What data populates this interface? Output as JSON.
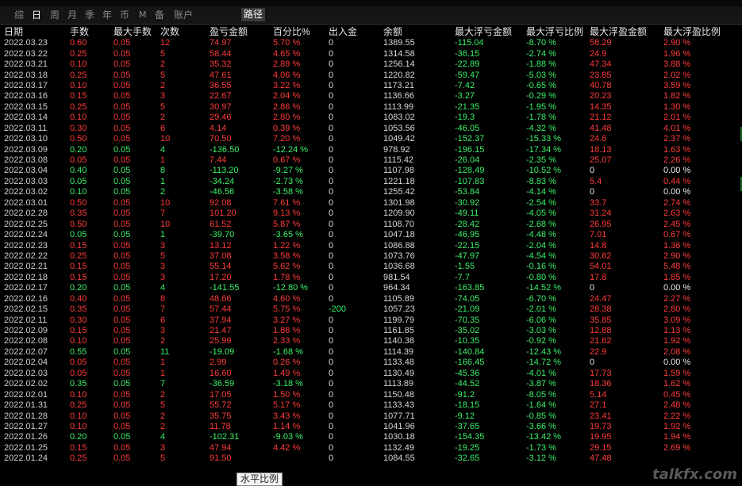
{
  "toolbar": {
    "periods": [
      "综",
      "日",
      "周",
      "月",
      "季",
      "年",
      "币",
      "M",
      "备",
      "账户"
    ],
    "active_period": "日",
    "path_button": "路径"
  },
  "columns": [
    "日期",
    "手数",
    "最大手数",
    "次数",
    "盈亏金额",
    "百分比%",
    "出入金",
    "余额",
    "最大浮亏金额",
    "最大浮亏比例",
    "最大浮盈金额",
    "最大浮盈比例"
  ],
  "rows": [
    [
      "2022.03.23",
      "0.60",
      "0.05",
      "12",
      "74.97",
      "5.70 %",
      "0",
      "1389.55",
      "-115.04",
      "-8.70 %",
      "58.29",
      "2.90 %"
    ],
    [
      "2022.03.22",
      "0.25",
      "0.05",
      "5",
      "58.44",
      "4.65 %",
      "0",
      "1314.58",
      "-36.15",
      "-2.74 %",
      "24.9",
      "1.96 %"
    ],
    [
      "2022.03.21",
      "0.10",
      "0.05",
      "2",
      "35.32",
      "2.89 %",
      "0",
      "1256.14",
      "-22.89",
      "-1.88 %",
      "47.34",
      "3.88 %"
    ],
    [
      "2022.03.18",
      "0.25",
      "0.05",
      "5",
      "47.61",
      "4.06 %",
      "0",
      "1220.82",
      "-59.47",
      "-5.03 %",
      "23.85",
      "2.02 %"
    ],
    [
      "2022.03.17",
      "0.10",
      "0.05",
      "2",
      "36.55",
      "3.22 %",
      "0",
      "1173.21",
      "-7.42",
      "-0.65 %",
      "40.78",
      "3.59 %"
    ],
    [
      "2022.03.16",
      "0.15",
      "0.05",
      "3",
      "22.67",
      "2.04 %",
      "0",
      "1136.66",
      "-3.27",
      "-0.29 %",
      "20.23",
      "1.82 %"
    ],
    [
      "2022.03.15",
      "0.25",
      "0.05",
      "5",
      "30.97",
      "2.86 %",
      "0",
      "1113.99",
      "-21.35",
      "-1.95 %",
      "14.35",
      "1.30 %"
    ],
    [
      "2022.03.14",
      "0.10",
      "0.05",
      "2",
      "29.46",
      "2.80 %",
      "0",
      "1083.02",
      "-19.3",
      "-1.78 %",
      "21.12",
      "2.01 %"
    ],
    [
      "2022.03.11",
      "0.30",
      "0.05",
      "6",
      "4.14",
      "0.39 %",
      "0",
      "1053.56",
      "-46.05",
      "-4.32 %",
      "41.48",
      "4.01 %"
    ],
    [
      "2022.03.10",
      "0.50",
      "0.05",
      "10",
      "70.50",
      "7.20 %",
      "0",
      "1049.42",
      "-152.37",
      "-15.33 %",
      "24.6",
      "2.37 %"
    ],
    [
      "2022.03.09",
      "0.20",
      "0.05",
      "4",
      "-136.50",
      "-12.24 %",
      "0",
      "978.92",
      "-196.15",
      "-17.34 %",
      "18.13",
      "1.63 %"
    ],
    [
      "2022.03.08",
      "0.05",
      "0.05",
      "1",
      "7.44",
      "0.67 %",
      "0",
      "1115.42",
      "-26.04",
      "-2.35 %",
      "25.07",
      "2.26 %"
    ],
    [
      "2022.03.04",
      "0.40",
      "0.05",
      "8",
      "-113.20",
      "-9.27 %",
      "0",
      "1107.98",
      "-128.49",
      "-10.52 %",
      "0",
      "0.00 %"
    ],
    [
      "2022.03.03",
      "0.05",
      "0.05",
      "1",
      "-34.24",
      "-2.73 %",
      "0",
      "1221.18",
      "-107.83",
      "-8.83 %",
      "5.4",
      "0.44 %"
    ],
    [
      "2022.03.02",
      "0.10",
      "0.05",
      "2",
      "-46.56",
      "-3.58 %",
      "0",
      "1255.42",
      "-53.84",
      "-4.14 %",
      "0",
      "0.00 %"
    ],
    [
      "2022.03.01",
      "0.50",
      "0.05",
      "10",
      "92.08",
      "7.61 %",
      "0",
      "1301.98",
      "-30.92",
      "-2.54 %",
      "33.7",
      "2.74 %"
    ],
    [
      "2022.02.28",
      "0.35",
      "0.05",
      "7",
      "101.20",
      "9.13 %",
      "0",
      "1209.90",
      "-49.11",
      "-4.05 %",
      "31.24",
      "2.63 %"
    ],
    [
      "2022.02.25",
      "0.50",
      "0.05",
      "10",
      "61.52",
      "5.87 %",
      "0",
      "1108.70",
      "-28.42",
      "-2.68 %",
      "26.95",
      "2.45 %"
    ],
    [
      "2022.02.24",
      "0.05",
      "0.05",
      "1",
      "-39.70",
      "-3.65 %",
      "0",
      "1047.18",
      "-46.95",
      "-4.48 %",
      "7.01",
      "0.67 %"
    ],
    [
      "2022.02.23",
      "0.15",
      "0.05",
      "3",
      "13.12",
      "1.22 %",
      "0",
      "1086.88",
      "-22.15",
      "-2.04 %",
      "14.8",
      "1.36 %"
    ],
    [
      "2022.02.22",
      "0.25",
      "0.05",
      "5",
      "37.08",
      "3.58 %",
      "0",
      "1073.76",
      "-47.97",
      "-4.54 %",
      "30.62",
      "2.90 %"
    ],
    [
      "2022.02.21",
      "0.15",
      "0.05",
      "3",
      "55.14",
      "5.62 %",
      "0",
      "1036.68",
      "-1.55",
      "-0.16 %",
      "54.01",
      "5.48 %"
    ],
    [
      "2022.02.18",
      "0.15",
      "0.05",
      "3",
      "17.20",
      "1.78 %",
      "0",
      "981.54",
      "-7.7",
      "-0.80 %",
      "17.8",
      "1.85 %"
    ],
    [
      "2022.02.17",
      "0.20",
      "0.05",
      "4",
      "-141.55",
      "-12.80 %",
      "0",
      "964.34",
      "-163.85",
      "-14.52 %",
      "0",
      "0.00 %"
    ],
    [
      "2022.02.16",
      "0.40",
      "0.05",
      "8",
      "48.66",
      "4.60 %",
      "0",
      "1105.89",
      "-74.05",
      "-6.70 %",
      "24.47",
      "2.27 %"
    ],
    [
      "2022.02.15",
      "0.35",
      "0.05",
      "7",
      "57.44",
      "5.75 %",
      "-200",
      "1057.23",
      "-21.09",
      "-2.01 %",
      "28.38",
      "2.80 %"
    ],
    [
      "2022.02.11",
      "0.30",
      "0.05",
      "6",
      "37.94",
      "3.27 %",
      "0",
      "1199.79",
      "-70.35",
      "-6.06 %",
      "35.85",
      "3.09 %"
    ],
    [
      "2022.02.09",
      "0.15",
      "0.05",
      "3",
      "21.47",
      "1.88 %",
      "0",
      "1161.85",
      "-35.02",
      "-3.03 %",
      "12.88",
      "1.13 %"
    ],
    [
      "2022.02.08",
      "0.10",
      "0.05",
      "2",
      "25.99",
      "2.33 %",
      "0",
      "1140.38",
      "-10.35",
      "-0.92 %",
      "21.62",
      "1.92 %"
    ],
    [
      "2022.02.07",
      "0.55",
      "0.05",
      "11",
      "-19.09",
      "-1.68 %",
      "0",
      "1114.39",
      "-140.84",
      "-12.43 %",
      "22.9",
      "2.08 %"
    ],
    [
      "2022.02.04",
      "0.05",
      "0.05",
      "1",
      "2.99",
      "0.26 %",
      "0",
      "1133.48",
      "-166.45",
      "-14.72 %",
      "0",
      "0.00 %"
    ],
    [
      "2022.02.03",
      "0.05",
      "0.05",
      "1",
      "16.60",
      "1.49 %",
      "0",
      "1130.49",
      "-45.36",
      "-4.01 %",
      "17.73",
      "1.59 %"
    ],
    [
      "2022.02.02",
      "0.35",
      "0.05",
      "7",
      "-36.59",
      "-3.18 %",
      "0",
      "1113.89",
      "-44.52",
      "-3.87 %",
      "18.36",
      "1.62 %"
    ],
    [
      "2022.02.01",
      "0.10",
      "0.05",
      "2",
      "17.05",
      "1.50 %",
      "0",
      "1150.48",
      "-91.2",
      "-8.05 %",
      "5.14",
      "0.45 %"
    ],
    [
      "2022.01.31",
      "0.25",
      "0.05",
      "5",
      "55.72",
      "5.17 %",
      "0",
      "1133.43",
      "-18.15",
      "-1.64 %",
      "27.1",
      "2.48 %"
    ],
    [
      "2022.01.28",
      "0.10",
      "0.05",
      "2",
      "35.75",
      "3.43 %",
      "0",
      "1077.71",
      "-9.12",
      "-0.85 %",
      "23.41",
      "2.22 %"
    ],
    [
      "2022.01.27",
      "0.10",
      "0.05",
      "2",
      "11.78",
      "1.14 %",
      "0",
      "1041.96",
      "-37.65",
      "-3.66 %",
      "19.73",
      "1.92 %"
    ],
    [
      "2022.01.26",
      "0.20",
      "0.05",
      "4",
      "-102.31",
      "-9.03 %",
      "0",
      "1030.18",
      "-154.35",
      "-13.42 %",
      "19.95",
      "1.94 %"
    ],
    [
      "2022.01.25",
      "0.15",
      "0.05",
      "3",
      "47.94",
      "4.42 %",
      "0",
      "1132.49",
      "-19.25",
      "-1.73 %",
      "29.15",
      "2.69 %"
    ],
    [
      "2022.01.24",
      "0.25",
      "0.05",
      "5",
      "91.50",
      "",
      "0",
      "1084.55",
      "-32.65",
      "-3.12 %",
      "47.48",
      ""
    ]
  ],
  "tooltip": "水平比例",
  "watermark": "talkfx.com"
}
